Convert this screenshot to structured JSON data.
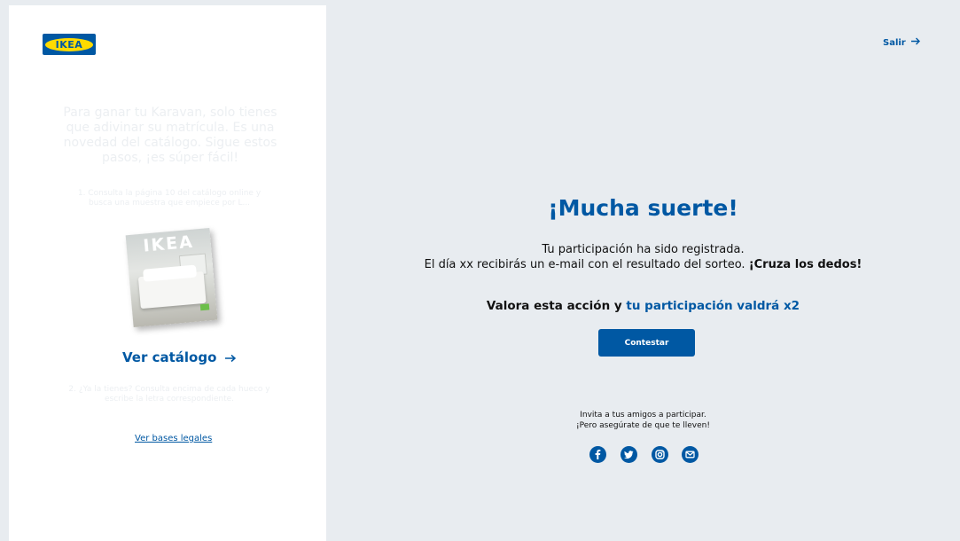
{
  "logo": {
    "text": "IKEA"
  },
  "left": {
    "intro_text": "Para ganar tu Karavan, solo tienes que adivinar su matrícula. Es una novedad del catálogo. Sigue estos pasos, ¡es súper fácil!",
    "step1": "1. Consulta la página 10 del catálogo online y busca una muestra que empiece por L...",
    "catalog_title": "IKEA",
    "ver_catalogo": "Ver catálogo",
    "step2": "2. ¿Ya la tienes? Consulta encima de cada hueco y escribe la letra correspondiente.",
    "ver_bases": "Ver bases legales"
  },
  "header": {
    "salir": "Salir"
  },
  "main": {
    "title": "¡Mucha suerte!",
    "line1": "Tu participación ha sido registrada.",
    "line2_prefix": "El día xx recibirás un e-mail con el resultado del sorteo.",
    "line2_bold": "¡Cruza los dedos!",
    "valora_prefix": "Valora esta acción y",
    "valora_highlight": "tu participación valdrá x2",
    "contestar": "Contestar",
    "invite_line1": "Invita a tus amigos a participar.",
    "invite_line2": "¡Pero asegúrate de que te lleven!"
  },
  "social_icons": [
    "facebook-icon",
    "twitter-icon",
    "instagram-icon",
    "email-icon"
  ],
  "colors": {
    "brand_blue": "#0058a3",
    "brand_yellow": "#ffdb00",
    "background": "#e8ecf0",
    "panel": "#ffffff"
  }
}
